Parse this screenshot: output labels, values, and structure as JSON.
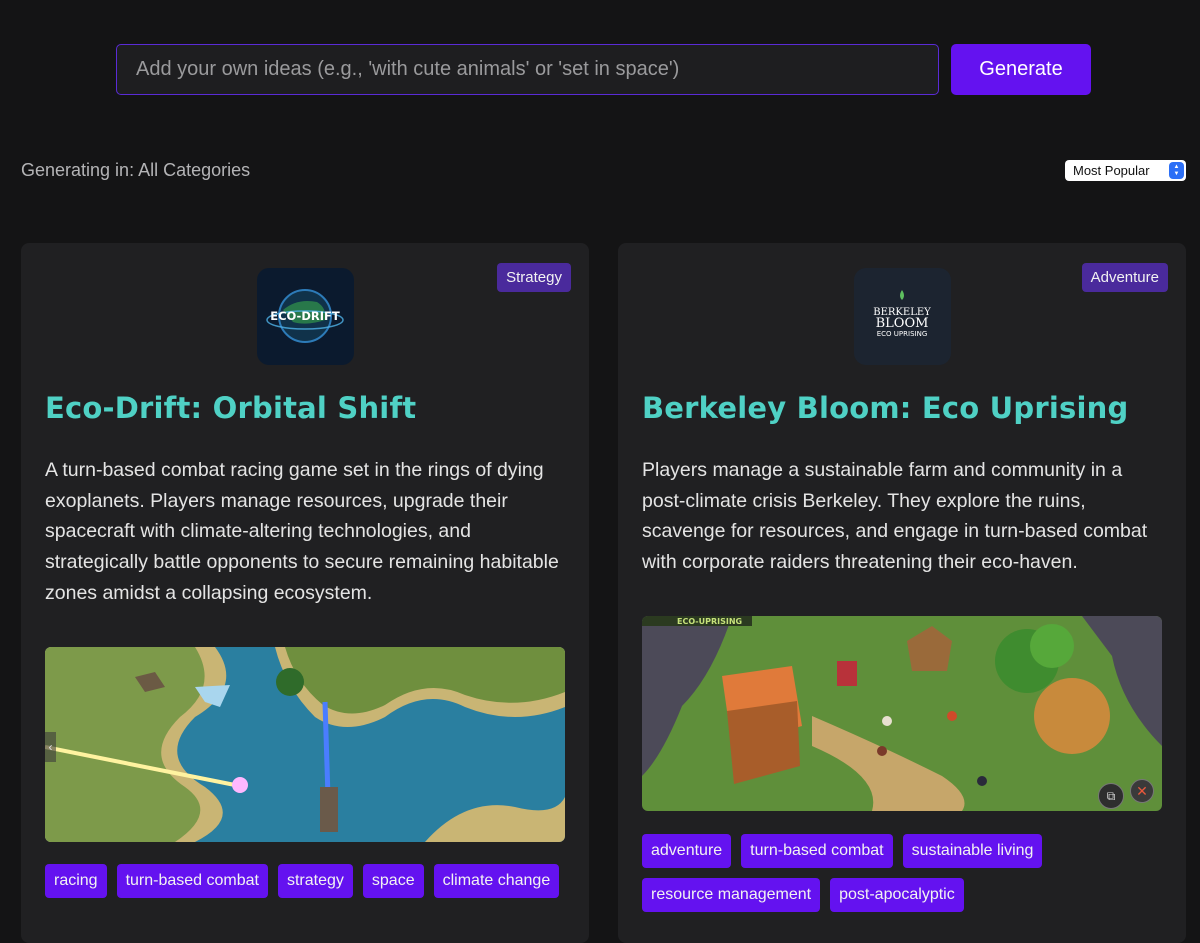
{
  "search": {
    "placeholder": "Add your own ideas (e.g., 'with cute animals' or 'set in space')",
    "value": ""
  },
  "generate_label": "Generate",
  "status_text": "Generating in: All Categories",
  "sort": {
    "selected": "Most Popular"
  },
  "games": [
    {
      "category": "Strategy",
      "logo_text": "ECO-DRIFT",
      "title": "Eco-Drift: Orbital Shift",
      "description": "A turn-based combat racing game set in the rings of dying exoplanets. Players manage resources, upgrade their spacecraft with climate-altering technologies, and strategically battle opponents to secure remaining habitable zones amidst a collapsing ecosystem.",
      "tags": [
        "racing",
        "turn-based combat",
        "strategy",
        "space",
        "climate change"
      ]
    },
    {
      "category": "Adventure",
      "logo_text": "BERKELEY BLOOM ECO UPRISING",
      "screenshot_banner": "ECO-UPRISING",
      "title": "Berkeley Bloom: Eco Uprising",
      "description": "Players manage a sustainable farm and community in a post-climate crisis Berkeley. They explore the ruins, scavenge for resources, and engage in turn-based combat with corporate raiders threatening their eco-haven.",
      "tags": [
        "adventure",
        "turn-based combat",
        "sustainable living",
        "resource management",
        "post-apocalyptic"
      ]
    }
  ],
  "colors": {
    "accent": "#6412f0",
    "badge": "#4a2a9c",
    "title": "#4fd1c5",
    "background": "#141415",
    "card": "#202022"
  }
}
